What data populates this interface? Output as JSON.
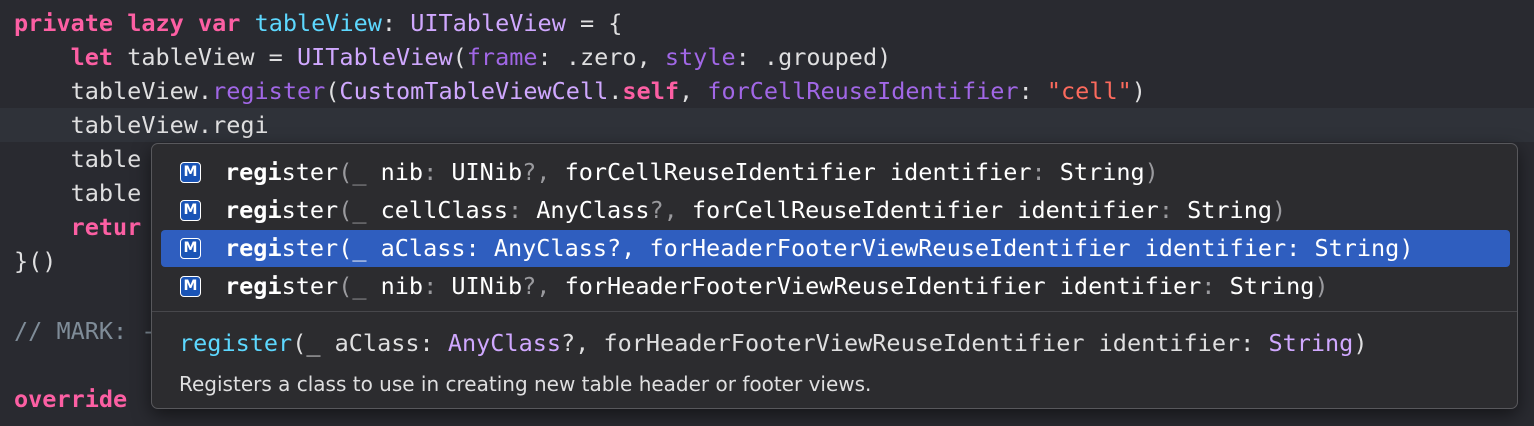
{
  "code": {
    "line1": {
      "kw_private": "private",
      "kw_lazy": "lazy",
      "kw_var": "var",
      "name": "tableView",
      "colon": ":",
      "type": "UITableView",
      "rest": " = {"
    },
    "line2": {
      "indent": "    ",
      "kw_let": "let",
      "name": " tableView = ",
      "type": "UITableView",
      "open": "(",
      "frame_label": "frame",
      "frame_val": ": .zero, ",
      "style_label": "style",
      "style_val": ": .grouped)"
    },
    "line3": {
      "indent": "    ",
      "recv": "tableView.",
      "method": "register",
      "open": "(",
      "cls": "CustomTableViewCell",
      "dot": ".",
      "self_kw": "self",
      "comma": ", ",
      "label": "forCellReuseIdentifier",
      "colon": ": ",
      "str": "\"cell\"",
      "close": ")"
    },
    "line4": {
      "text": "    tableView.regi"
    },
    "line5": {
      "text": "    table"
    },
    "line6": {
      "text": "    table"
    },
    "line7": {
      "indent": "    ",
      "kw": "retur"
    },
    "line8": {
      "text": "}()"
    },
    "line10": {
      "text": "// MARK: -"
    },
    "line12": {
      "kw": "override"
    }
  },
  "completion": {
    "items": [
      {
        "match": "regi",
        "rest": "ster",
        "p1": "(_ ",
        "a1": "nib",
        "p2": ": ",
        "a2": "UINib",
        "p3": "?, ",
        "a3": "forCellReuseIdentifier identifier",
        "p4": ": ",
        "a4": "String",
        "p5": ")"
      },
      {
        "match": "regi",
        "rest": "ster",
        "p1": "(_ ",
        "a1": "cellClass",
        "p2": ": ",
        "a2": "AnyClass",
        "p3": "?, ",
        "a3": "forCellReuseIdentifier identifier",
        "p4": ": ",
        "a4": "String",
        "p5": ")"
      },
      {
        "match": "regi",
        "rest": "ster",
        "p1": "(_ ",
        "a1": "aClass",
        "p2": ": ",
        "a2": "AnyClass",
        "p3": "?, ",
        "a3": "forHeaderFooterViewReuseIdentifier identifier",
        "p4": ": ",
        "a4": "String",
        "p5": ")"
      },
      {
        "match": "regi",
        "rest": "ster",
        "p1": "(_ ",
        "a1": "nib",
        "p2": ": ",
        "a2": "UINib",
        "p3": "?, ",
        "a3": "forHeaderFooterViewReuseIdentifier identifier",
        "p4": ": ",
        "a4": "String",
        "p5": ")"
      }
    ],
    "badge_letter": "M",
    "detail": {
      "fn": "register",
      "open": "(_ aClass: ",
      "type1": "AnyClass",
      "mid": "?, forHeaderFooterViewReuseIdentifier identifier: ",
      "type2": "String",
      "close": ")",
      "description": "Registers a class to use in creating new table header or footer views."
    }
  }
}
